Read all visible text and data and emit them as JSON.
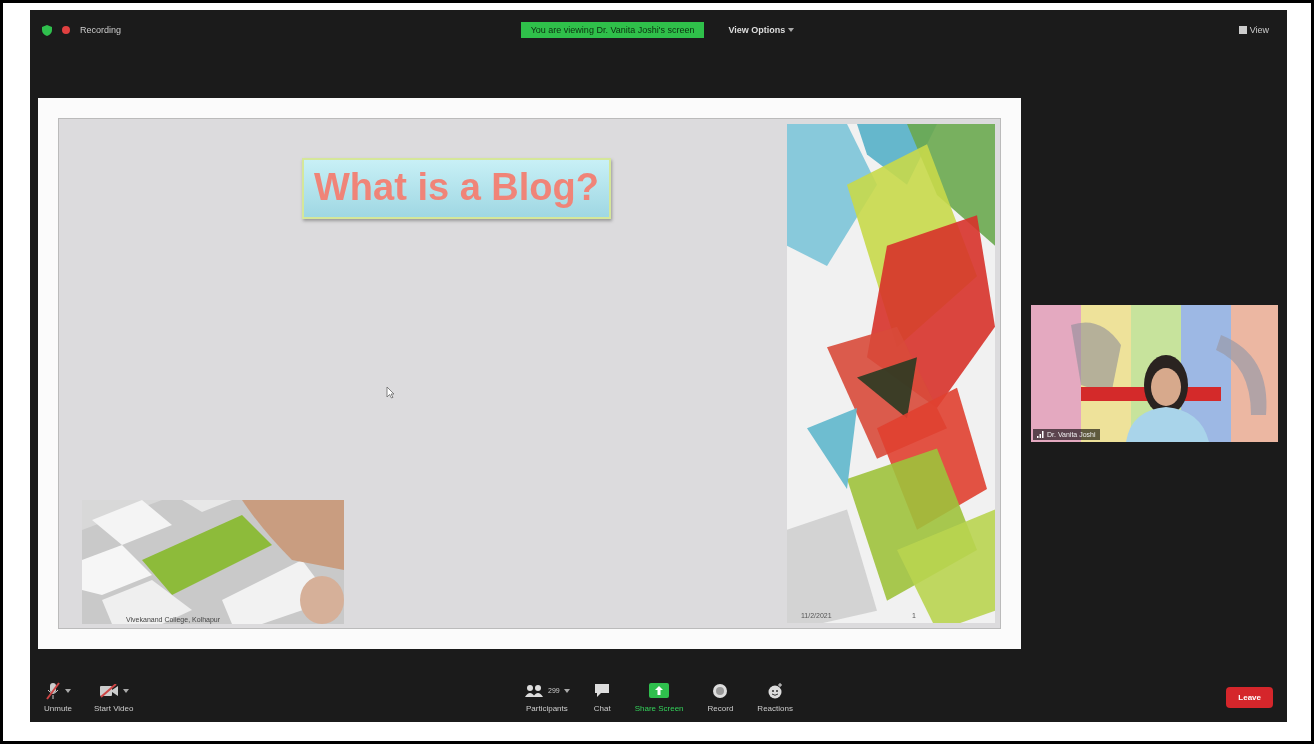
{
  "top_bar": {
    "recording": "Recording",
    "sharing_banner": "You are viewing Dr. Vanita Joshi's screen",
    "view_options": "View Options",
    "view_button": "View"
  },
  "slide": {
    "title": "What is a Blog?",
    "footer": "Vivekanand College, Kolhapur",
    "date": "11/2/2021",
    "page": "1"
  },
  "video_tile": {
    "name": "Dr. Vanita Joshi"
  },
  "toolbar": {
    "left": [
      {
        "kind": "mic",
        "label": "Unmute",
        "muted": true,
        "has_menu": true
      },
      {
        "kind": "video",
        "label": "Start Video",
        "muted": true,
        "has_menu": true
      }
    ],
    "center": [
      {
        "kind": "participants",
        "label": "Participants",
        "count": "299",
        "has_menu": true,
        "highlighted": false
      },
      {
        "kind": "chat",
        "label": "Chat",
        "has_menu": false,
        "highlighted": false
      },
      {
        "kind": "share",
        "label": "Share Screen",
        "has_menu": false,
        "highlighted": true
      },
      {
        "kind": "record",
        "label": "Record",
        "has_menu": false,
        "highlighted": false
      },
      {
        "kind": "reactions",
        "label": "Reactions",
        "has_menu": false,
        "highlighted": false
      }
    ],
    "leave": "Leave"
  }
}
